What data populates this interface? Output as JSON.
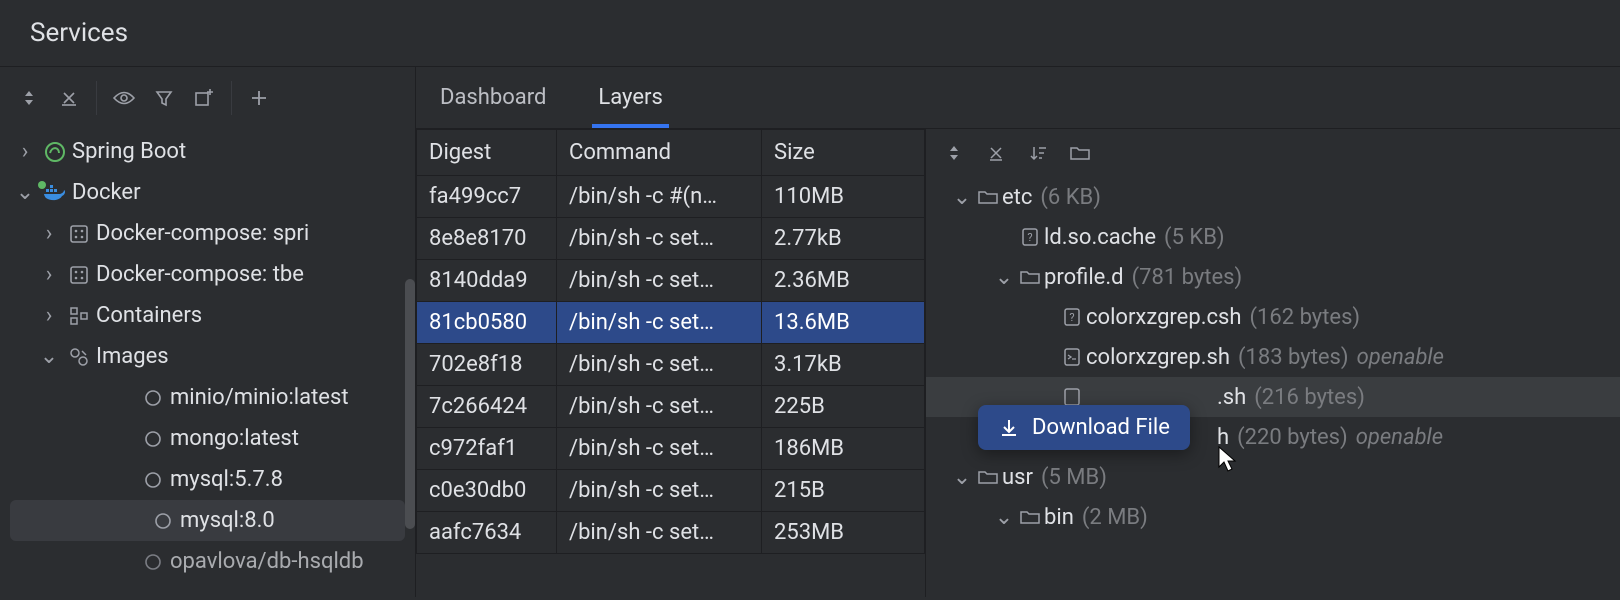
{
  "panel": {
    "title": "Services"
  },
  "tree": {
    "springboot": {
      "label": "Spring Boot"
    },
    "docker": {
      "label": "Docker",
      "compose1": "Docker-compose: spri",
      "compose2": "Docker-compose: tbe",
      "containers": "Containers",
      "images": {
        "label": "Images",
        "items": [
          "minio/minio:latest",
          "mongo:latest",
          "mysql:5.7.8",
          "mysql:8.0",
          "opavlova/db-hsqldb"
        ]
      }
    }
  },
  "tabs": {
    "dashboard": "Dashboard",
    "layers": "Layers"
  },
  "layers_table": {
    "headers": {
      "digest": "Digest",
      "command": "Command",
      "size": "Size"
    },
    "rows": [
      {
        "digest": "fa499cc7",
        "command": "/bin/sh -c #(n…",
        "size": "110MB"
      },
      {
        "digest": "8e8e8170",
        "command": "/bin/sh -c set…",
        "size": "2.77kB"
      },
      {
        "digest": "8140dda9",
        "command": "/bin/sh -c set…",
        "size": "2.36MB"
      },
      {
        "digest": "81cb0580",
        "command": "/bin/sh -c set…",
        "size": "13.6MB"
      },
      {
        "digest": "702e8f18",
        "command": "/bin/sh -c set…",
        "size": "3.17kB"
      },
      {
        "digest": "7c266424",
        "command": "/bin/sh -c set…",
        "size": "225B"
      },
      {
        "digest": "c972faf1",
        "command": "/bin/sh -c set…",
        "size": "186MB"
      },
      {
        "digest": "c0e30db0",
        "command": "/bin/sh -c set…",
        "size": "215B"
      },
      {
        "digest": "aafc7634",
        "command": "/bin/sh -c set…",
        "size": "253MB"
      }
    ],
    "selected_index": 3
  },
  "file_tree": {
    "etc": {
      "name": "etc",
      "size": "(6 KB)"
    },
    "ldso": {
      "name": "ld.so.cache",
      "size": "(5 KB)"
    },
    "profiled": {
      "name": "profile.d",
      "size": "(781 bytes)"
    },
    "csh": {
      "name": "colorxzgrep.csh",
      "size": "(162 bytes)"
    },
    "sh": {
      "name": "colorxzgrep.sh",
      "size": "(183 bytes)",
      "tag": "openable"
    },
    "hidden1": {
      "name": ".sh",
      "size": "(216 bytes)"
    },
    "hidden2": {
      "name": "h",
      "size": "(220 bytes)",
      "tag": "openable"
    },
    "usr": {
      "name": "usr",
      "size": "(5 MB)"
    },
    "bin": {
      "name": "bin",
      "size": "(2 MB)"
    }
  },
  "popup": {
    "label": "Download File"
  }
}
